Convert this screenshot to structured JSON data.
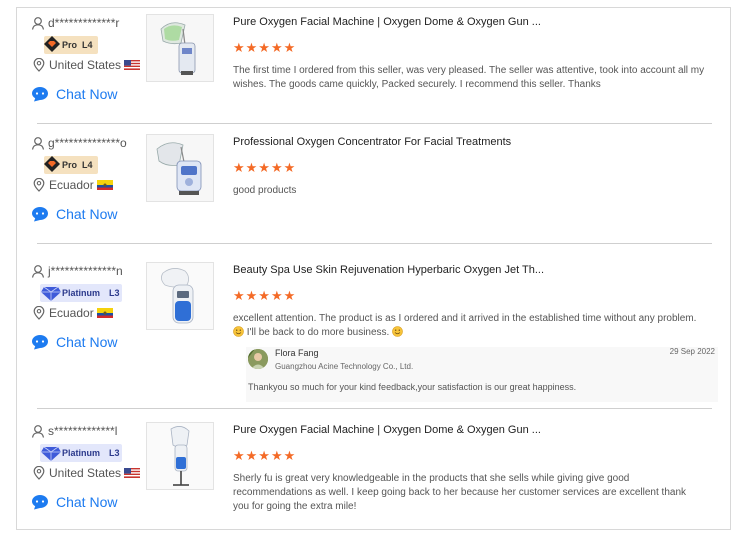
{
  "colors": {
    "accent_orange": "#f46a26",
    "link_blue": "#1d7bf0",
    "pro_badge_bg": "#f5e1bf",
    "platinum_badge_bg": "#e3e7fb"
  },
  "reviews": [
    {
      "buyer": "d*************r",
      "badge": {
        "type": "pro",
        "tier": "Pro",
        "level": "L4"
      },
      "country": "United States",
      "flag": "us-flag",
      "chat_label": "Chat Now",
      "title": "Pure Oxygen Facial Machine | Oxygen Dome & Oxygen Gun ...",
      "rating": 5,
      "stars_text": "★★★★★",
      "text": "The first time I ordered from this seller, was very pleased. The seller was attentive, took into account all my wishes. The goods came quickly, Packed securely. I recommend this seller. Thanks",
      "product_image": "oxygen-dome-machine-image"
    },
    {
      "buyer": "g**************o",
      "badge": {
        "type": "pro",
        "tier": "Pro",
        "level": "L4"
      },
      "country": "Ecuador",
      "flag": "ecuador-flag",
      "chat_label": "Chat Now",
      "title": "Professional Oxygen Concentrator For Facial Treatments",
      "rating": 5,
      "stars_text": "★★★★★",
      "text": "good products",
      "product_image": "oxygen-concentrator-image"
    },
    {
      "buyer": "j**************n",
      "badge": {
        "type": "platinum",
        "tier": "Platinum",
        "level": "L3"
      },
      "country": "Ecuador",
      "flag": "ecuador-flag",
      "chat_label": "Chat Now",
      "title": "Beauty Spa Use Skin Rejuvenation Hyperbaric Oxygen Jet Th...",
      "rating": 5,
      "stars_text": "★★★★★",
      "text_line1": "excellent attention. The product is as I ordered and it arrived in the established time without any problem.",
      "text_line2": "I'll be back to do more business.",
      "product_image": "hyperbaric-oxygen-jet-image",
      "reply": {
        "name": "Flora Fang",
        "company": "Guangzhou Acine Technology Co., Ltd.",
        "date": "29 Sep 2022",
        "text": "Thankyou so much for your kind feedback,your satisfaction is our great happiness."
      }
    },
    {
      "buyer": "s*************l",
      "badge": {
        "type": "platinum",
        "tier": "Platinum",
        "level": "L3"
      },
      "country": "United States",
      "flag": "us-flag",
      "chat_label": "Chat Now",
      "title": "Pure Oxygen Facial Machine | Oxygen Dome & Oxygen Gun ...",
      "rating": 5,
      "stars_text": "★★★★★",
      "text": "Sherly fu is great very knowledgeable in the products that she sells while giving give good recommendations as well. I keep going back to her because her customer services are excellent thank you for going the extra mile!",
      "product_image": "oxygen-dome-stand-image"
    }
  ]
}
